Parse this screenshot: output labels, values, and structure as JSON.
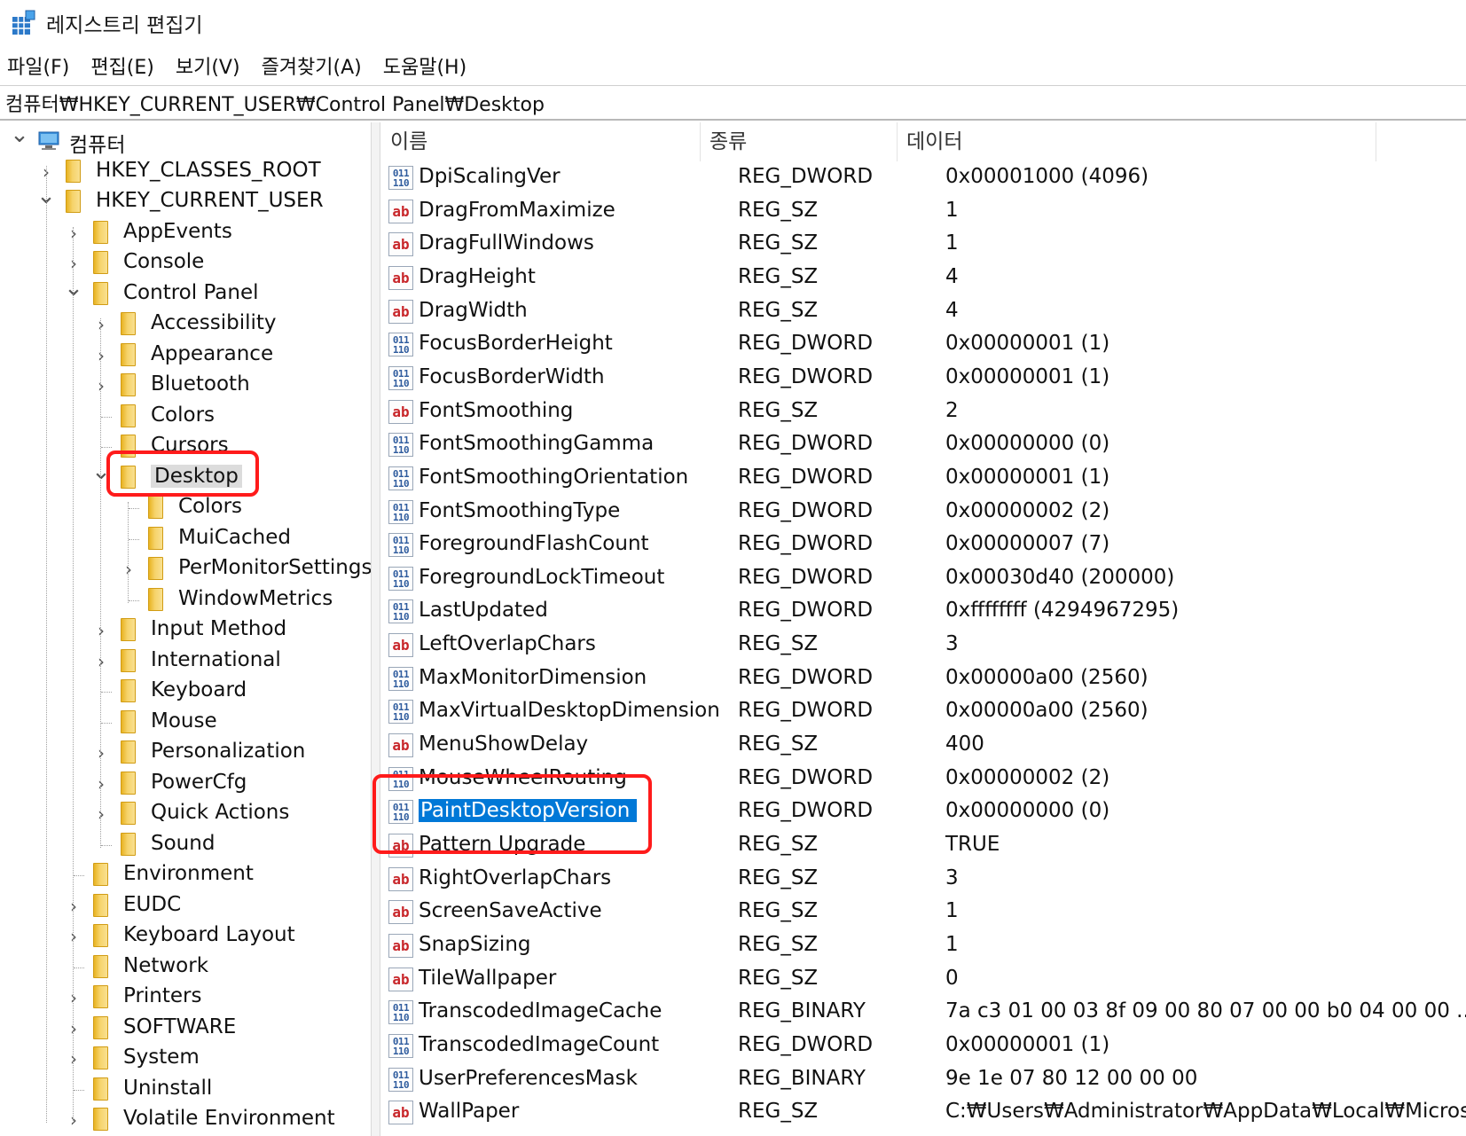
{
  "window": {
    "title": "레지스트리 편집기"
  },
  "menu": [
    "파일(F)",
    "편집(E)",
    "보기(V)",
    "즐겨찾기(A)",
    "도움말(H)"
  ],
  "address": "컴퓨터₩HKEY_CURRENT_USER₩Control Panel₩Desktop",
  "tree": [
    {
      "label": "컴퓨터",
      "level": 0,
      "expander": "open",
      "icon": "computer"
    },
    {
      "label": "HKEY_CLASSES_ROOT",
      "level": 1,
      "expander": "closed"
    },
    {
      "label": "HKEY_CURRENT_USER",
      "level": 1,
      "expander": "open"
    },
    {
      "label": "AppEvents",
      "level": 2,
      "expander": "closed"
    },
    {
      "label": "Console",
      "level": 2,
      "expander": "closed"
    },
    {
      "label": "Control Panel",
      "level": 2,
      "expander": "open"
    },
    {
      "label": "Accessibility",
      "level": 3,
      "expander": "closed"
    },
    {
      "label": "Appearance",
      "level": 3,
      "expander": "closed"
    },
    {
      "label": "Bluetooth",
      "level": 3,
      "expander": "closed"
    },
    {
      "label": "Colors",
      "level": 3,
      "expander": "none"
    },
    {
      "label": "Cursors",
      "level": 3,
      "expander": "none"
    },
    {
      "label": "Desktop",
      "level": 3,
      "expander": "open",
      "selected": true
    },
    {
      "label": "Colors",
      "level": 4,
      "expander": "none"
    },
    {
      "label": "MuiCached",
      "level": 4,
      "expander": "none"
    },
    {
      "label": "PerMonitorSettings",
      "level": 4,
      "expander": "closed"
    },
    {
      "label": "WindowMetrics",
      "level": 4,
      "expander": "none"
    },
    {
      "label": "Input Method",
      "level": 3,
      "expander": "closed"
    },
    {
      "label": "International",
      "level": 3,
      "expander": "closed"
    },
    {
      "label": "Keyboard",
      "level": 3,
      "expander": "none"
    },
    {
      "label": "Mouse",
      "level": 3,
      "expander": "none"
    },
    {
      "label": "Personalization",
      "level": 3,
      "expander": "closed"
    },
    {
      "label": "PowerCfg",
      "level": 3,
      "expander": "closed"
    },
    {
      "label": "Quick Actions",
      "level": 3,
      "expander": "closed"
    },
    {
      "label": "Sound",
      "level": 3,
      "expander": "none"
    },
    {
      "label": "Environment",
      "level": 2,
      "expander": "none"
    },
    {
      "label": "EUDC",
      "level": 2,
      "expander": "closed"
    },
    {
      "label": "Keyboard Layout",
      "level": 2,
      "expander": "closed"
    },
    {
      "label": "Network",
      "level": 2,
      "expander": "none"
    },
    {
      "label": "Printers",
      "level": 2,
      "expander": "closed"
    },
    {
      "label": "SOFTWARE",
      "level": 2,
      "expander": "closed"
    },
    {
      "label": "System",
      "level": 2,
      "expander": "closed"
    },
    {
      "label": "Uninstall",
      "level": 2,
      "expander": "none"
    },
    {
      "label": "Volatile Environment",
      "level": 2,
      "expander": "closed"
    }
  ],
  "columns": {
    "name": "이름",
    "type": "종류",
    "data": "데이터"
  },
  "values": [
    {
      "name": "DpiScalingVer",
      "type": "REG_DWORD",
      "data": "0x00001000 (4096)"
    },
    {
      "name": "DragFromMaximize",
      "type": "REG_SZ",
      "data": "1"
    },
    {
      "name": "DragFullWindows",
      "type": "REG_SZ",
      "data": "1"
    },
    {
      "name": "DragHeight",
      "type": "REG_SZ",
      "data": "4"
    },
    {
      "name": "DragWidth",
      "type": "REG_SZ",
      "data": "4"
    },
    {
      "name": "FocusBorderHeight",
      "type": "REG_DWORD",
      "data": "0x00000001 (1)"
    },
    {
      "name": "FocusBorderWidth",
      "type": "REG_DWORD",
      "data": "0x00000001 (1)"
    },
    {
      "name": "FontSmoothing",
      "type": "REG_SZ",
      "data": "2"
    },
    {
      "name": "FontSmoothingGamma",
      "type": "REG_DWORD",
      "data": "0x00000000 (0)"
    },
    {
      "name": "FontSmoothingOrientation",
      "type": "REG_DWORD",
      "data": "0x00000001 (1)"
    },
    {
      "name": "FontSmoothingType",
      "type": "REG_DWORD",
      "data": "0x00000002 (2)"
    },
    {
      "name": "ForegroundFlashCount",
      "type": "REG_DWORD",
      "data": "0x00000007 (7)"
    },
    {
      "name": "ForegroundLockTimeout",
      "type": "REG_DWORD",
      "data": "0x00030d40 (200000)"
    },
    {
      "name": "LastUpdated",
      "type": "REG_DWORD",
      "data": "0xffffffff (4294967295)"
    },
    {
      "name": "LeftOverlapChars",
      "type": "REG_SZ",
      "data": "3"
    },
    {
      "name": "MaxMonitorDimension",
      "type": "REG_DWORD",
      "data": "0x00000a00 (2560)"
    },
    {
      "name": "MaxVirtualDesktopDimension",
      "type": "REG_DWORD",
      "data": "0x00000a00 (2560)"
    },
    {
      "name": "MenuShowDelay",
      "type": "REG_SZ",
      "data": "400"
    },
    {
      "name": "MouseWheelRouting",
      "type": "REG_DWORD",
      "data": "0x00000002 (2)"
    },
    {
      "name": "PaintDesktopVersion",
      "type": "REG_DWORD",
      "data": "0x00000000 (0)",
      "selected": true
    },
    {
      "name": "Pattern Upgrade",
      "type": "REG_SZ",
      "data": "TRUE"
    },
    {
      "name": "RightOverlapChars",
      "type": "REG_SZ",
      "data": "3"
    },
    {
      "name": "ScreenSaveActive",
      "type": "REG_SZ",
      "data": "1"
    },
    {
      "name": "SnapSizing",
      "type": "REG_SZ",
      "data": "1"
    },
    {
      "name": "TileWallpaper",
      "type": "REG_SZ",
      "data": "0"
    },
    {
      "name": "TranscodedImageCache",
      "type": "REG_BINARY",
      "data": "7a c3 01 00 03 8f 09 00 80 07 00 00 b0 04 00 00 ..."
    },
    {
      "name": "TranscodedImageCount",
      "type": "REG_DWORD",
      "data": "0x00000001 (1)"
    },
    {
      "name": "UserPreferencesMask",
      "type": "REG_BINARY",
      "data": "9e 1e 07 80 12 00 00 00"
    },
    {
      "name": "WallPaper",
      "type": "REG_SZ",
      "data": "C:₩Users₩Administrator₩AppData₩Local₩Micros..."
    }
  ],
  "colors": {
    "selection": "#0078d7",
    "highlight": "#ff1b1b",
    "folder": "#e8b322"
  }
}
